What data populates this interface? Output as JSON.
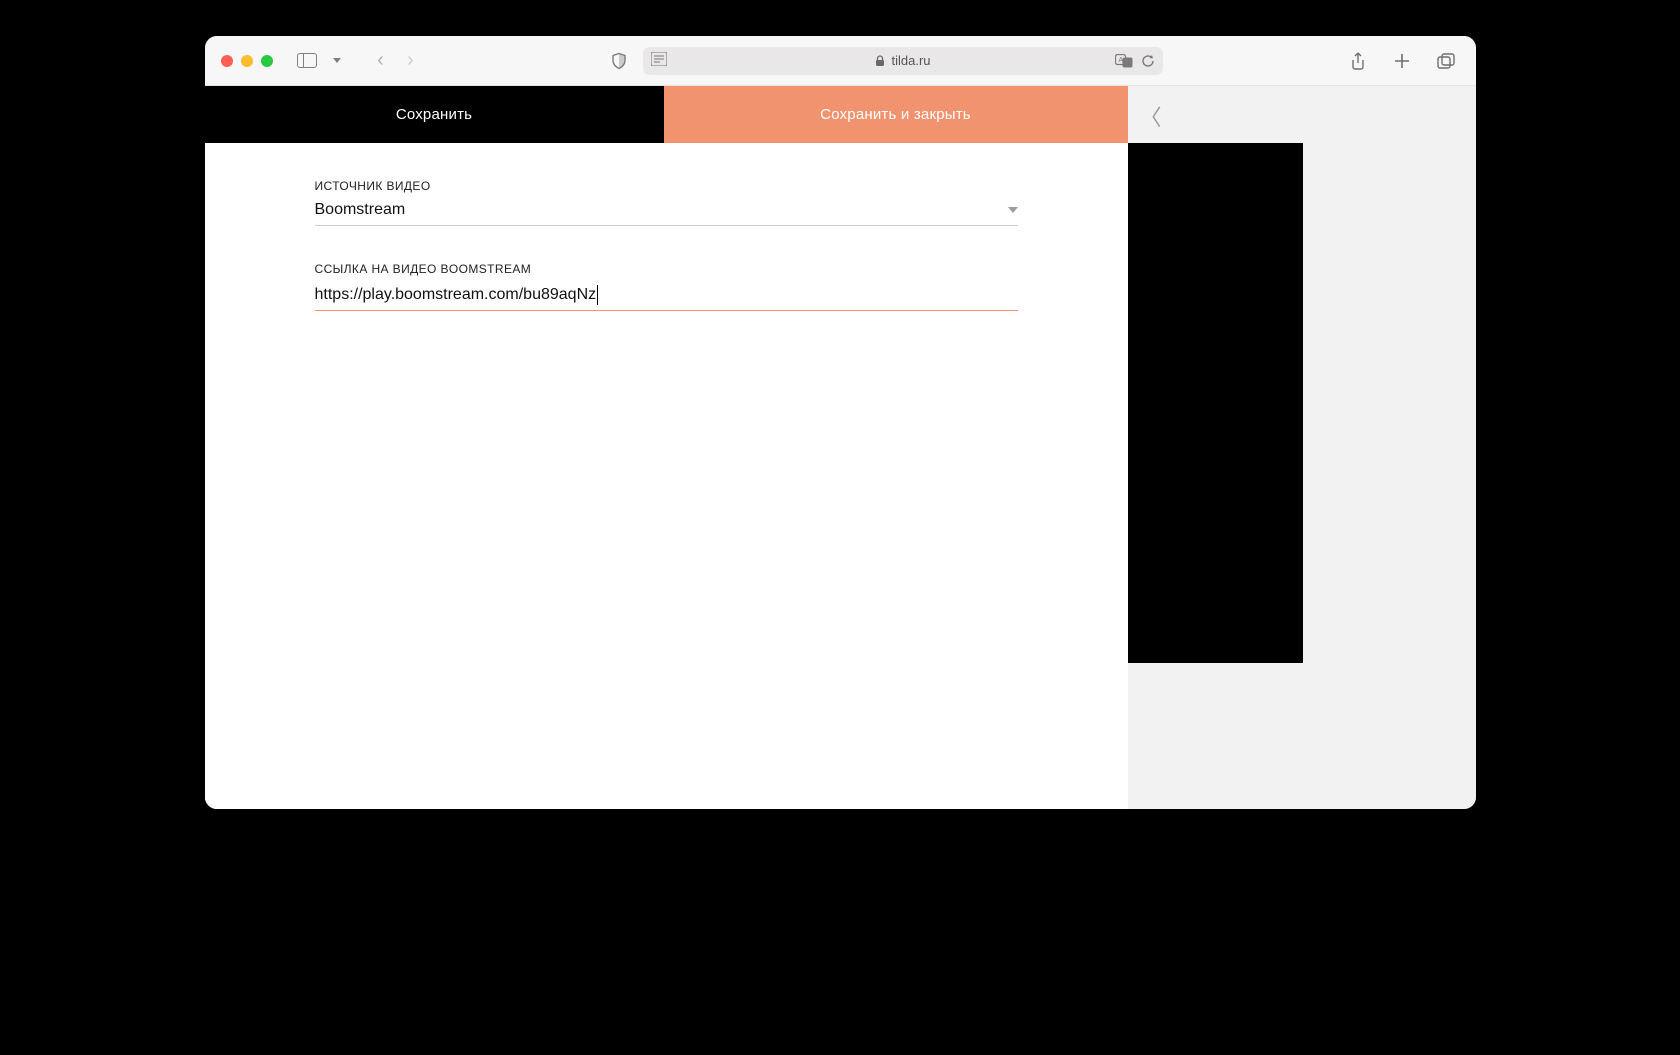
{
  "browser": {
    "url_host": "tilda.ru"
  },
  "editor": {
    "buttons": {
      "save": "Сохранить",
      "save_close": "Сохранить и закрыть"
    },
    "video_source": {
      "label": "ИСТОЧНИК ВИДЕО",
      "value": "Boomstream"
    },
    "video_link": {
      "label": "ССЫЛКА НА ВИДЕО BOOMSTREAM",
      "value": "https://play.boomstream.com/bu89aqNz"
    }
  }
}
